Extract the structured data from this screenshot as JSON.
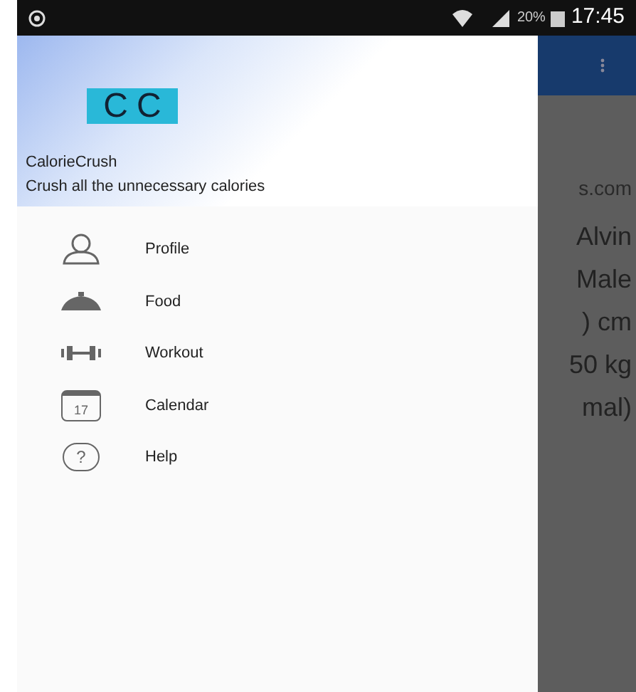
{
  "status_bar": {
    "battery": "20%",
    "time": "17:45"
  },
  "drawer": {
    "logo_letters": [
      "C",
      "C"
    ],
    "app_name": "CalorieCrush",
    "tagline": "Crush all the unnecessary calories",
    "items": [
      {
        "kind": "profile",
        "label": "Profile"
      },
      {
        "kind": "food",
        "label": "Food"
      },
      {
        "kind": "workout",
        "label": "Workout"
      },
      {
        "kind": "calendar",
        "label": "Calendar",
        "icon_text": "17"
      },
      {
        "kind": "help",
        "label": "Help",
        "icon_text": "?"
      }
    ]
  },
  "background_lines": [
    "s.com",
    "Alvin",
    "Male",
    ") cm",
    "50 kg",
    "mal)"
  ]
}
